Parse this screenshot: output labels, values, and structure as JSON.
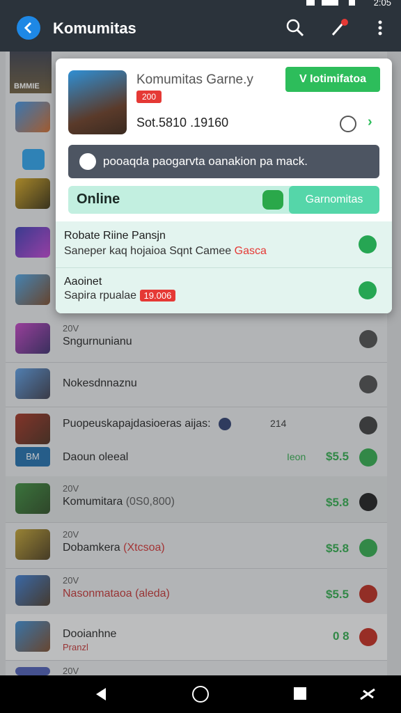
{
  "status": {
    "time": "2:05"
  },
  "appbar": {
    "title": "Komumitas"
  },
  "card": {
    "game_name": "Komumitas Garne.y",
    "badge": "200",
    "stats": "Sot.5810 .19160",
    "join_label": "V Iotimifatoa",
    "banner_text": "pooaqda paogarvta oanakion pa mack.",
    "online_label": "Online",
    "community_button": "Garnomitas",
    "items": [
      {
        "title": "Robate Riine Pansjn",
        "subtitle": "Saneper kaq hojaioa Sqnt Camee",
        "accent": "Gasca"
      },
      {
        "title": "Aaoinet",
        "subtitle": "Sapira rpualae",
        "badge": "19.006"
      }
    ]
  },
  "list": {
    "side_logo": "BMMIE",
    "rows": [
      {
        "year": "20V",
        "title": "Sngurnunianu"
      },
      {
        "title": "Nokesdnnaznu"
      },
      {
        "title": "Puopeuskapajdasioeras aijas:",
        "extra": "214"
      },
      {
        "tag": "BM",
        "title": "Daoun oleeal",
        "note": "Ieon",
        "price": "$5.5"
      },
      {
        "year": "20V",
        "title": "Komumitara",
        "paren": "(0S0,800)",
        "price": "$5.8"
      },
      {
        "year": "20V",
        "title": "Dobamkera",
        "paren": "(Xtcsoa)",
        "price": "$5.8"
      },
      {
        "year": "20V",
        "title": "Nasonmataoa",
        "paren": "(aleda)",
        "price": "$5.5"
      },
      {
        "title": "Dooianhne",
        "sub": "Pranzl",
        "price": "0 8"
      },
      {
        "year": "20V"
      }
    ]
  },
  "colors": {
    "appbar": "#2b333b",
    "accent_blue": "#1e88e5",
    "green": "#2dbd5b",
    "mint": "#55d6a9",
    "red": "#e53935"
  }
}
